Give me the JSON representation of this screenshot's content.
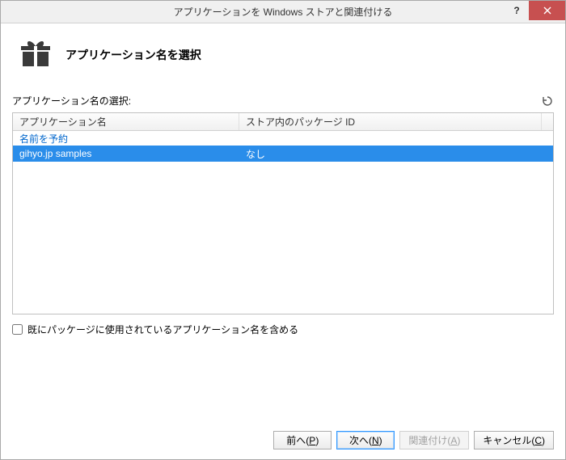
{
  "window": {
    "title": "アプリケーションを Windows ストアと関連付ける"
  },
  "header": {
    "heading": "アプリケーション名を選択"
  },
  "list": {
    "label": "アプリケーション名の選択:",
    "columns": {
      "name": "アプリケーション名",
      "pkgid": "ストア内のパッケージ ID"
    },
    "reserve_link": "名前を予約",
    "rows": [
      {
        "name": "gihyo.jp samples",
        "pkgid": "なし",
        "selected": true
      }
    ]
  },
  "checkbox": {
    "label": "既にパッケージに使用されているアプリケーション名を含める",
    "checked": false
  },
  "buttons": {
    "prev": {
      "text": "前へ(",
      "key": "P",
      "suffix": ")"
    },
    "next": {
      "text": "次へ(",
      "key": "N",
      "suffix": ")"
    },
    "assoc": {
      "text": "関連付け(",
      "key": "A",
      "suffix": ")",
      "disabled": true
    },
    "cancel": {
      "text": "キャンセル(",
      "key": "C",
      "suffix": ")"
    }
  }
}
